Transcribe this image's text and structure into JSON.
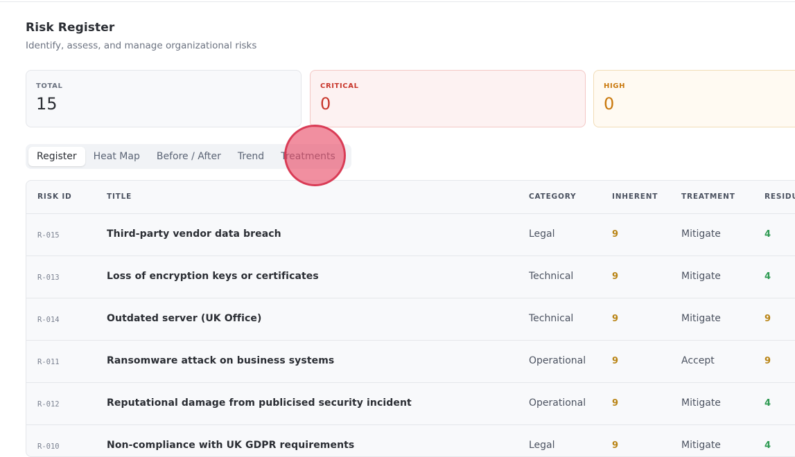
{
  "header": {
    "title": "Risk Register",
    "subtitle": "Identify, assess, and manage organizational risks"
  },
  "stats": {
    "total": {
      "label": "TOTAL",
      "value": "15"
    },
    "critical": {
      "label": "CRITICAL",
      "value": "0"
    },
    "high": {
      "label": "HIGH",
      "value": "0"
    }
  },
  "tabs": [
    {
      "label": "Register"
    },
    {
      "label": "Heat Map"
    },
    {
      "label": "Before / After"
    },
    {
      "label": "Trend"
    },
    {
      "label": "Treatments"
    }
  ],
  "colors": {
    "critical": "#c8362b",
    "high": "#c9780c",
    "inherent_score": "#b98414",
    "residual_low": "#2e9a52",
    "residual_high": "#b98414"
  },
  "table": {
    "headers": {
      "id": "RISK ID",
      "title": "TITLE",
      "category": "CATEGORY",
      "inherent": "INHERENT",
      "treatment": "TREATMENT",
      "residual": "RESIDU"
    },
    "rows": [
      {
        "id": "R-015",
        "title": "Third-party vendor data breach",
        "category": "Legal",
        "inherent": "9",
        "treatment": "Mitigate",
        "residual": "4"
      },
      {
        "id": "R-013",
        "title": "Loss of encryption keys or certificates",
        "category": "Technical",
        "inherent": "9",
        "treatment": "Mitigate",
        "residual": "4"
      },
      {
        "id": "R-014",
        "title": "Outdated server (UK Office)",
        "category": "Technical",
        "inherent": "9",
        "treatment": "Mitigate",
        "residual": "9"
      },
      {
        "id": "R-011",
        "title": "Ransomware attack on business systems",
        "category": "Operational",
        "inherent": "9",
        "treatment": "Accept",
        "residual": "9"
      },
      {
        "id": "R-012",
        "title": "Reputational damage from publicised security incident",
        "category": "Operational",
        "inherent": "9",
        "treatment": "Mitigate",
        "residual": "4"
      },
      {
        "id": "R-010",
        "title": "Non-compliance with UK GDPR requirements",
        "category": "Legal",
        "inherent": "9",
        "treatment": "Mitigate",
        "residual": "4"
      }
    ]
  }
}
